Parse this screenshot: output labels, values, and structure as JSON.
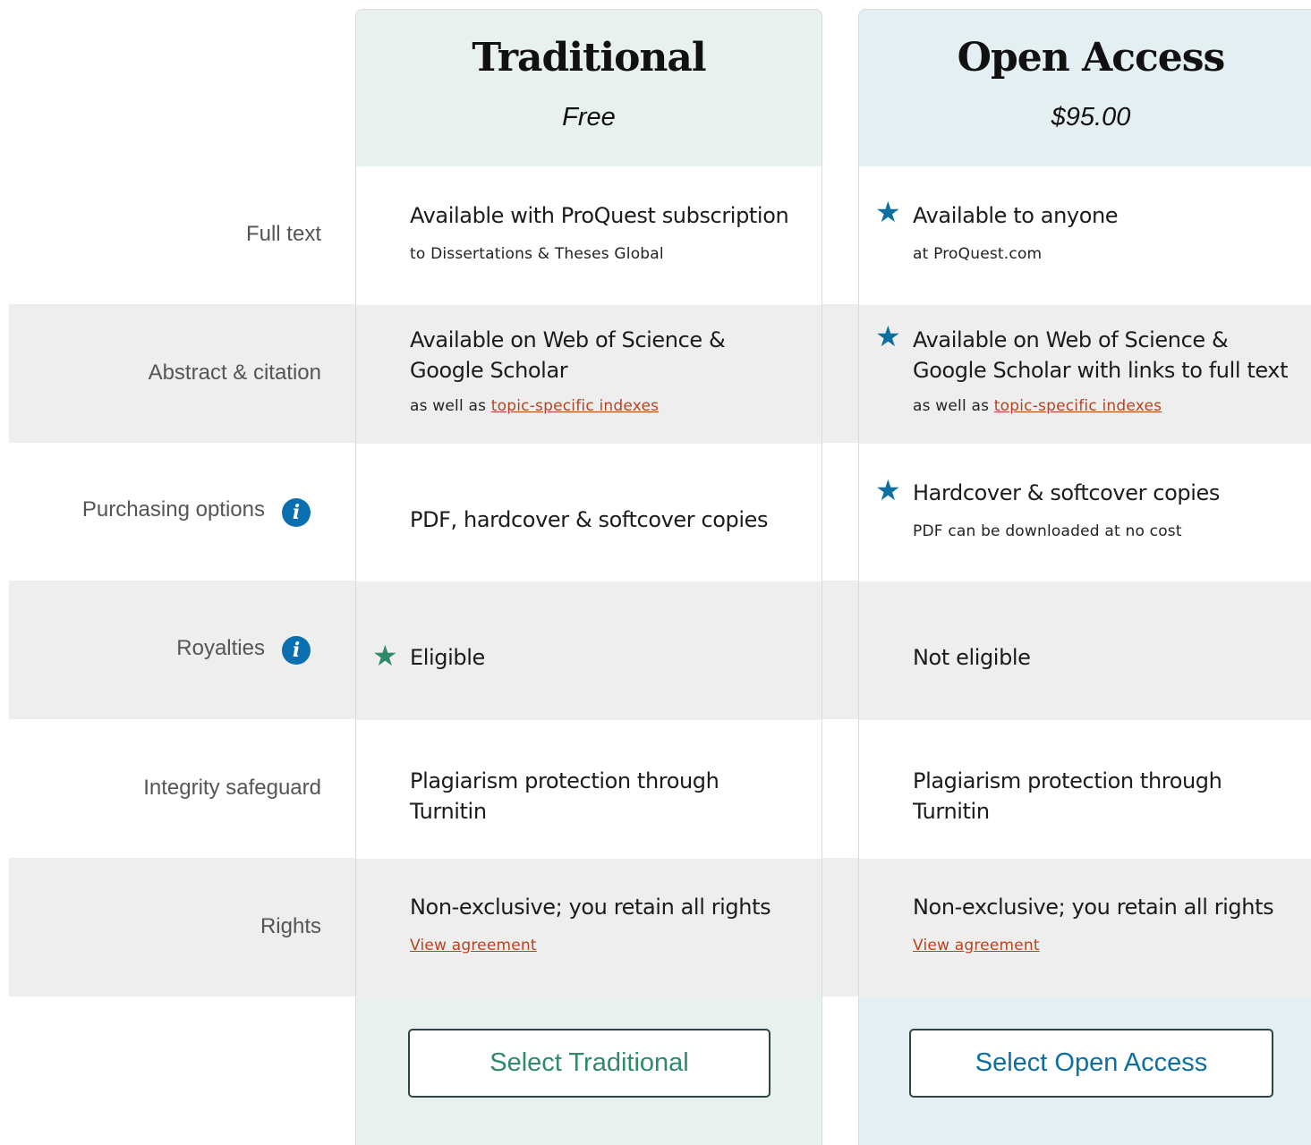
{
  "colors": {
    "traditional_header_bg": "#e8f1ee",
    "open_access_header_bg": "#e4eff1",
    "traditional_accent": "#2f8a67",
    "open_access_accent": "#0b6fa3",
    "link": "#b9431c",
    "info_icon": "#0a6fb0"
  },
  "rows": [
    {
      "label": "Full text",
      "info": false
    },
    {
      "label": "Abstract & citation",
      "info": false
    },
    {
      "label": "Purchasing options",
      "info": true,
      "info_icon": "info-icon"
    },
    {
      "label": "Royalties",
      "info": true,
      "info_icon": "info-icon"
    },
    {
      "label": "Integrity safeguard",
      "info": false
    },
    {
      "label": "Rights",
      "info": false
    }
  ],
  "plans": {
    "traditional": {
      "title": "Traditional",
      "price": "Free",
      "button_label": "Select Traditional",
      "cells": {
        "full_text": {
          "main": "Available with ProQuest subscription",
          "sub": "to Dissertations & Theses Global"
        },
        "abstract": {
          "main_line1": "Available on Web of Science &",
          "main_line2": "Google Scholar",
          "sub_prefix": "as well as ",
          "sub_link": "topic-specific indexes"
        },
        "purchasing": {
          "main": "PDF, hardcover & softcover copies"
        },
        "royalties": {
          "main": "Eligible",
          "star_icon": "star-icon"
        },
        "integrity": {
          "main_line1": "Plagiarism protection through",
          "main_line2": "Turnitin"
        },
        "rights": {
          "main": "Non-exclusive; you retain all rights",
          "link": "View agreement"
        }
      }
    },
    "open_access": {
      "title": "Open Access",
      "price": "$95.00",
      "button_label": "Select Open Access",
      "cells": {
        "full_text": {
          "main": "Available to anyone",
          "sub": "at ProQuest.com",
          "star_icon": "star-icon"
        },
        "abstract": {
          "main_line1": "Available on Web of Science &",
          "main_line2": "Google Scholar with links to full text",
          "sub_prefix": "as well as ",
          "sub_link": "topic-specific indexes",
          "star_icon": "star-icon"
        },
        "purchasing": {
          "main": "Hardcover & softcover copies",
          "sub": "PDF can be downloaded at no cost",
          "star_icon": "star-icon"
        },
        "royalties": {
          "main": "Not eligible"
        },
        "integrity": {
          "main_line1": "Plagiarism protection through",
          "main_line2": "Turnitin"
        },
        "rights": {
          "main": "Non-exclusive; you retain all rights",
          "link": "View agreement"
        }
      }
    }
  }
}
